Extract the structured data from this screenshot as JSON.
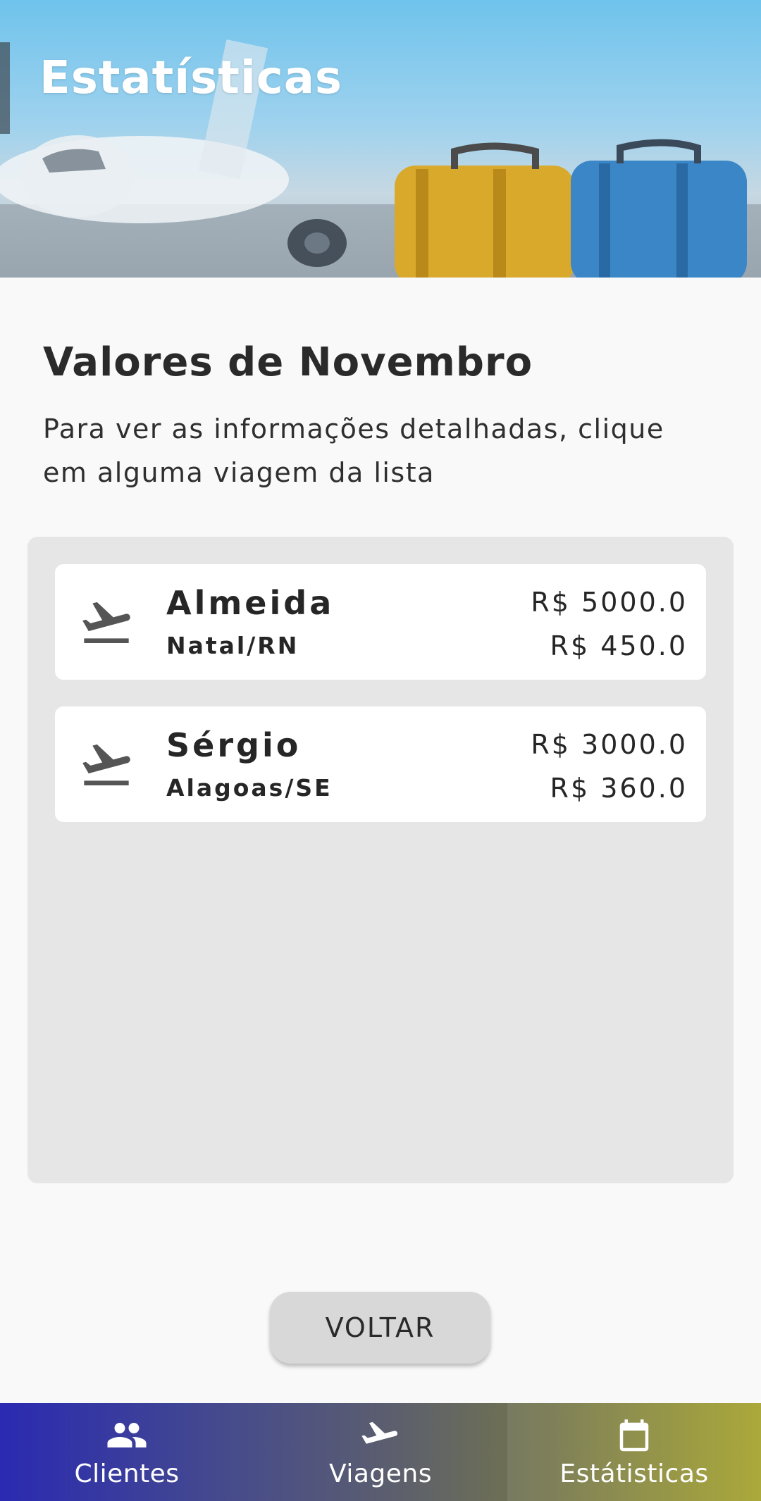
{
  "header": {
    "title": "Estatísticas"
  },
  "intro": {
    "title": "Valores de Novembro",
    "description": "Para ver as informações detalhadas, clique em alguma viagem da lista"
  },
  "trips": [
    {
      "name": "Almeida",
      "destination": "Natal/RN",
      "value1": "R$ 5000.0",
      "value2": "R$ 450.0",
      "icon": "airplane-icon"
    },
    {
      "name": "Sérgio",
      "destination": "Alagoas/SE",
      "value1": "R$ 3000.0",
      "value2": "R$ 360.0",
      "icon": "airplane-icon"
    }
  ],
  "actions": {
    "back_label": "VOLTAR"
  },
  "nav": {
    "items": [
      {
        "label": "Clientes",
        "icon": "people-icon",
        "active": false
      },
      {
        "label": "Viagens",
        "icon": "airplane-icon",
        "active": false
      },
      {
        "label": "Estátisticas",
        "icon": "calendar-icon",
        "active": true
      }
    ]
  },
  "colors": {
    "icon_gray": "#555555",
    "nav_left": "#2a2ab2",
    "nav_right": "#a4a22a",
    "panel_bg": "#e6e6e6"
  }
}
